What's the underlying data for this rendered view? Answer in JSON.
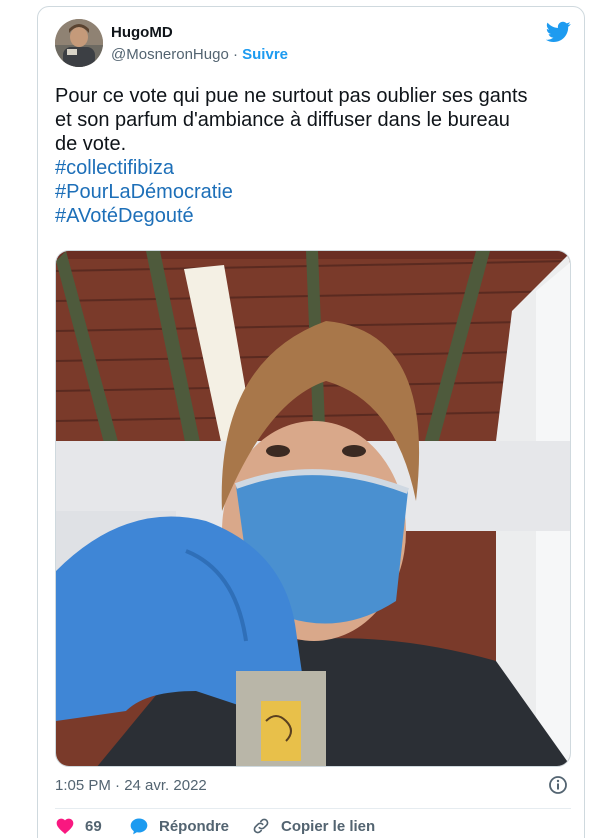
{
  "tweet": {
    "author_name": "HugoMD",
    "handle": "@MosneronHugo",
    "separator": " · ",
    "follow_label": "Suivre",
    "text_lines": [
      "Pour ce vote qui pue ne surtout pas oublier ses gants",
      "et son parfum d'ambiance à diffuser dans le bureau",
      "de vote."
    ],
    "hashtags": [
      "#collectifibiza",
      "#PourLaDémocratie",
      "#AVotéDegouté"
    ],
    "timestamp": "1:05 PM · 24 avr. 2022",
    "likes": "69",
    "reply_label": "Répondre",
    "copy_link_label": "Copier le lien"
  },
  "colors": {
    "link": "#1d9bf0",
    "hashtag": "#1d6fb8",
    "like": "#f91880",
    "text": "#0f1419",
    "muted": "#536471"
  },
  "icons": [
    "twitter-bird-icon",
    "info-icon",
    "heart-icon",
    "reply-bubble-icon",
    "link-icon"
  ]
}
